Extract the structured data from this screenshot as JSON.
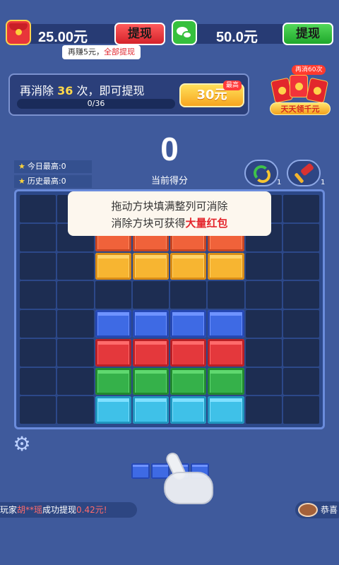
{
  "balances": {
    "cash_amount": "25.00元",
    "cash_withdraw": "提现",
    "wechat_amount": "50.0元",
    "wechat_withdraw": "提现",
    "earn_prefix": "再赚5元，",
    "earn_link": "全部提现"
  },
  "progress": {
    "text_prefix": "再消除",
    "count": "36",
    "text_suffix": "次，即可提现",
    "label": "0/36",
    "fraction": 0.0,
    "reward": "30元",
    "max_badge": "最高"
  },
  "daily": {
    "badge": "再消60次",
    "label": "天天领千元"
  },
  "scores": {
    "today_best": "今日最高:0",
    "history_best": "历史最高:0",
    "current": "0",
    "current_label": "当前得分"
  },
  "tools": {
    "refresh_count": "1",
    "hammer_count": "1"
  },
  "tip": {
    "line1": "拖动方块填满整列可消除",
    "line2_prefix": "消除方块可获得",
    "line2_highlight": "大量红包"
  },
  "board": {
    "rows": [
      [
        "",
        "",
        "",
        "",
        "",
        "",
        "",
        ""
      ],
      [
        "",
        "",
        "orange",
        "orange",
        "orange",
        "orange",
        "",
        ""
      ],
      [
        "",
        "",
        "yellow",
        "yellow",
        "yellow",
        "yellow",
        "",
        ""
      ],
      [
        "",
        "",
        "",
        "",
        "",
        "",
        "",
        ""
      ],
      [
        "",
        "",
        "blue",
        "blue",
        "blue",
        "blue",
        "",
        ""
      ],
      [
        "",
        "",
        "red",
        "red",
        "red",
        "red",
        "",
        ""
      ],
      [
        "",
        "",
        "green",
        "green",
        "green",
        "green",
        "",
        ""
      ],
      [
        "",
        "",
        "cyan",
        "cyan",
        "cyan",
        "cyan",
        "",
        ""
      ]
    ]
  },
  "ticker": {
    "prefix": "玩家",
    "name": "胡**瑶",
    "middle": "成功提现",
    "amount": "0.42元!",
    "second": "恭喜"
  },
  "colors": {
    "background": "#3f5a9c",
    "accent_red": "#e4262c",
    "accent_yellow": "#ffd84a"
  }
}
